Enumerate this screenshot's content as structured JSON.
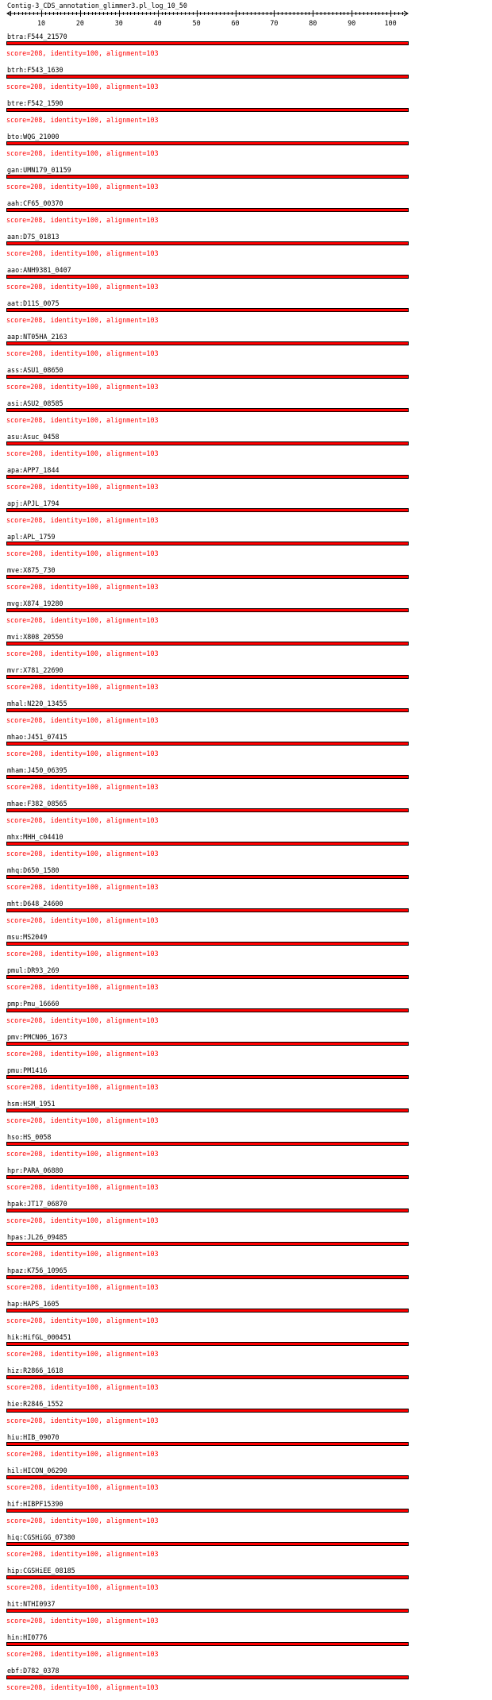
{
  "title": "Contig-3_CDS_annotation_glimmer3.pl_log_10_50",
  "colors": {
    "bar": "#ff0000",
    "bar_border": "#000000",
    "score_text": "#ff0000"
  },
  "ruler": {
    "min": 1,
    "max": 104,
    "labels": [
      "10",
      "20",
      "30",
      "40",
      "50",
      "60",
      "70",
      "80",
      "90",
      "100"
    ]
  },
  "hits": [
    {
      "name": "btra:F544_21570",
      "score": "score=208, identity=100, alignment=103"
    },
    {
      "name": "btrh:F543_1630",
      "score": "score=208, identity=100, alignment=103"
    },
    {
      "name": "btre:F542_1590",
      "score": "score=208, identity=100, alignment=103"
    },
    {
      "name": "bto:WQG_21000",
      "score": "score=208, identity=100, alignment=103"
    },
    {
      "name": "gan:UMN179_01159",
      "score": "score=208, identity=100, alignment=103"
    },
    {
      "name": "aah:CF65_00370",
      "score": "score=208, identity=100, alignment=103"
    },
    {
      "name": "aan:D7S_01813",
      "score": "score=208, identity=100, alignment=103"
    },
    {
      "name": "aao:ANH9381_0407",
      "score": "score=208, identity=100, alignment=103"
    },
    {
      "name": "aat:D11S_0075",
      "score": "score=208, identity=100, alignment=103"
    },
    {
      "name": "aap:NT05HA_2163",
      "score": "score=208, identity=100, alignment=103"
    },
    {
      "name": "ass:ASU1_08650",
      "score": "score=208, identity=100, alignment=103"
    },
    {
      "name": "asi:ASU2_08585",
      "score": "score=208, identity=100, alignment=103"
    },
    {
      "name": "asu:Asuc_0458",
      "score": "score=208, identity=100, alignment=103"
    },
    {
      "name": "apa:APP7_1844",
      "score": "score=208, identity=100, alignment=103"
    },
    {
      "name": "apj:APJL_1794",
      "score": "score=208, identity=100, alignment=103"
    },
    {
      "name": "apl:APL_1759",
      "score": "score=208, identity=100, alignment=103"
    },
    {
      "name": "mve:X875_730",
      "score": "score=208, identity=100, alignment=103"
    },
    {
      "name": "mvg:X874_19280",
      "score": "score=208, identity=100, alignment=103"
    },
    {
      "name": "mvi:X808_20550",
      "score": "score=208, identity=100, alignment=103"
    },
    {
      "name": "mvr:X781_22690",
      "score": "score=208, identity=100, alignment=103"
    },
    {
      "name": "mhal:N220_13455",
      "score": "score=208, identity=100, alignment=103"
    },
    {
      "name": "mhao:J451_07415",
      "score": "score=208, identity=100, alignment=103"
    },
    {
      "name": "mham:J450_06395",
      "score": "score=208, identity=100, alignment=103"
    },
    {
      "name": "mhae:F382_08565",
      "score": "score=208, identity=100, alignment=103"
    },
    {
      "name": "mhx:MHH_c04410",
      "score": "score=208, identity=100, alignment=103"
    },
    {
      "name": "mhq:D650_1580",
      "score": "score=208, identity=100, alignment=103"
    },
    {
      "name": "mht:D648_24600",
      "score": "score=208, identity=100, alignment=103"
    },
    {
      "name": "msu:MS2049",
      "score": "score=208, identity=100, alignment=103"
    },
    {
      "name": "pmul:DR93_269",
      "score": "score=208, identity=100, alignment=103"
    },
    {
      "name": "pmp:Pmu_16660",
      "score": "score=208, identity=100, alignment=103"
    },
    {
      "name": "pmv:PMCN06_1673",
      "score": "score=208, identity=100, alignment=103"
    },
    {
      "name": "pmu:PM1416",
      "score": "score=208, identity=100, alignment=103"
    },
    {
      "name": "hsm:HSM_1951",
      "score": "score=208, identity=100, alignment=103"
    },
    {
      "name": "hso:HS_0058",
      "score": "score=208, identity=100, alignment=103"
    },
    {
      "name": "hpr:PARA_06880",
      "score": "score=208, identity=100, alignment=103"
    },
    {
      "name": "hpak:JT17_06870",
      "score": "score=208, identity=100, alignment=103"
    },
    {
      "name": "hpas:JL26_09485",
      "score": "score=208, identity=100, alignment=103"
    },
    {
      "name": "hpaz:K756_10965",
      "score": "score=208, identity=100, alignment=103"
    },
    {
      "name": "hap:HAPS_1605",
      "score": "score=208, identity=100, alignment=103"
    },
    {
      "name": "hik:HifGL_000451",
      "score": "score=208, identity=100, alignment=103"
    },
    {
      "name": "hiz:R2866_1618",
      "score": "score=208, identity=100, alignment=103"
    },
    {
      "name": "hie:R2846_1552",
      "score": "score=208, identity=100, alignment=103"
    },
    {
      "name": "hiu:HIB_09070",
      "score": "score=208, identity=100, alignment=103"
    },
    {
      "name": "hil:HICON_06290",
      "score": "score=208, identity=100, alignment=103"
    },
    {
      "name": "hif:HIBPF15390",
      "score": "score=208, identity=100, alignment=103"
    },
    {
      "name": "hiq:CGSHiGG_07380",
      "score": "score=208, identity=100, alignment=103"
    },
    {
      "name": "hip:CGSHiEE_08185",
      "score": "score=208, identity=100, alignment=103"
    },
    {
      "name": "hit:NTHI0937",
      "score": "score=208, identity=100, alignment=103"
    },
    {
      "name": "hin:HI0776",
      "score": "score=208, identity=100, alignment=103"
    },
    {
      "name": "ebf:D782_0378",
      "score": "score=208, identity=100, alignment=103"
    }
  ]
}
